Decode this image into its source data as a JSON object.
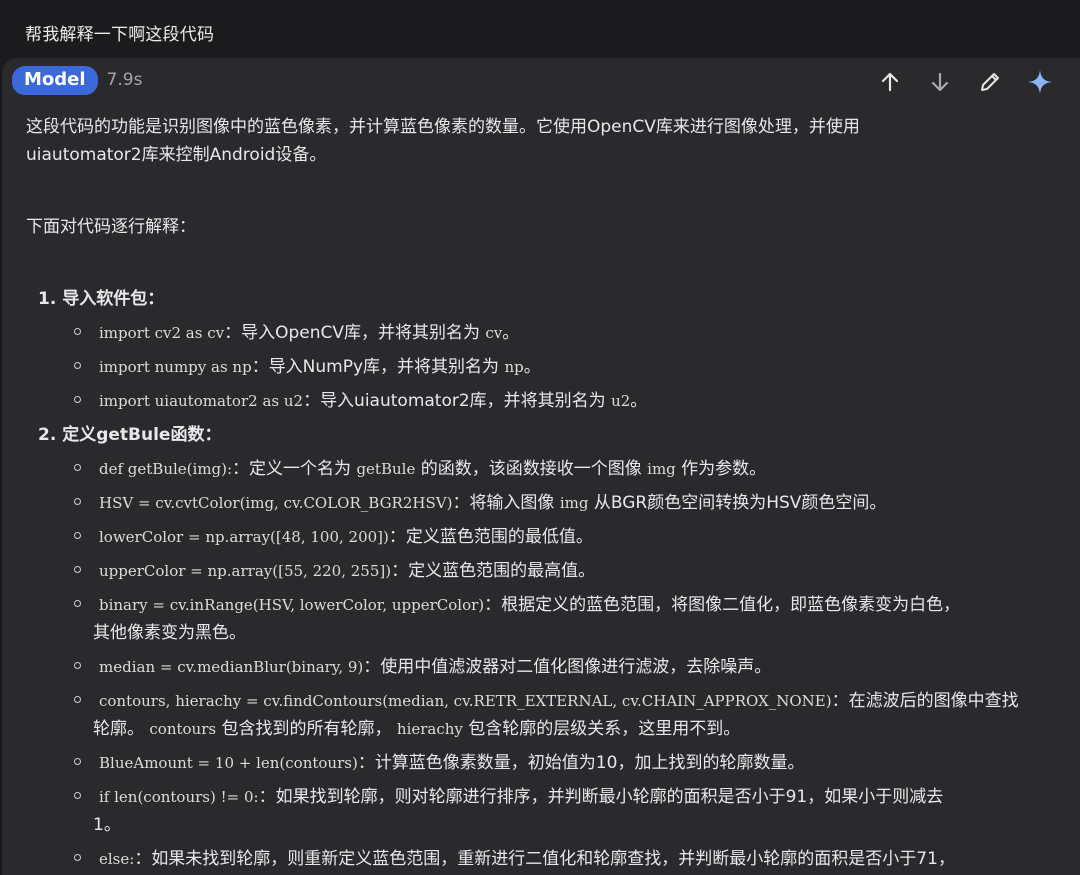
{
  "user_prompt": "帮我解释一下啊这段代码",
  "header": {
    "model_label": "Model",
    "time": "7.9s",
    "actions": [
      "arrow-up-icon",
      "arrow-down-icon",
      "pencil-icon",
      "sparkle-icon"
    ]
  },
  "intro": {
    "line1": "这段代码的功能是识别图像中的蓝色像素，并计算蓝色像素的数量。它使用OpenCV库来进行图像处理，并使用",
    "line2": "uiautomator2库来控制Android设备。"
  },
  "sub_intro": "下面对代码逐行解释：",
  "sections": [
    {
      "title": "1. 导入软件包：",
      "items": [
        {
          "code": "import cv2 as cv",
          "sep": "：",
          "text": "导入OpenCV库，并将其别名为",
          "code2": "cv",
          "tail": "。"
        },
        {
          "code": "import numpy as np",
          "sep": "：",
          "text": "导入NumPy库，并将其别名为",
          "code2": "np",
          "tail": "。"
        },
        {
          "code": "import uiautomator2 as u2",
          "sep": "：",
          "text": "导入uiautomator2库，并将其别名为",
          "code2": "u2",
          "tail": "。"
        }
      ]
    },
    {
      "title": "2. 定义getBule函数：",
      "items": [
        {
          "code": "def getBule(img):",
          "sep": "：",
          "text": "定义一个名为",
          "code2": "getBule",
          "text2": "的函数，该函数接收一个图像",
          "code3": "img",
          "text3": "作为参数。"
        },
        {
          "code": "HSV = cv.cvtColor(img, cv.COLOR_BGR2HSV)",
          "sep": "：",
          "text": "将输入图像",
          "code2": "img",
          "text2": "从BGR颜色空间转换为HSV颜色空间。"
        },
        {
          "code": "lowerColor = np.array([48, 100, 200])",
          "sep": "：",
          "text": "定义蓝色范围的最低值。"
        },
        {
          "code": "upperColor = np.array([55, 220, 255])",
          "sep": "：",
          "text": "定义蓝色范围的最高值。"
        },
        {
          "code": "binary = cv.inRange(HSV, lowerColor, upperColor)",
          "sep": "：",
          "text": "根据定义的蓝色范围，将图像二值化，即蓝色像素变为白色，",
          "line2": "其他像素变为黑色。"
        },
        {
          "code": "median = cv.medianBlur(binary, 9)",
          "sep": "：",
          "text": "使用中值滤波器对二值化图像进行滤波，去除噪声。"
        },
        {
          "code": "contours, hierachy = cv.findContours(median, cv.RETR_EXTERNAL, cv.CHAIN_APPROX_NONE)",
          "sep": "：",
          "text": "在滤波后的图像中查找",
          "line2_text": "轮廓。",
          "line2_code": "contours",
          "line2_text2": "包含找到的所有轮廓，",
          "line2_code2": "hierachy",
          "line2_text3": "包含轮廓的层级关系，这里用不到。"
        },
        {
          "code": "BlueAmount = 10 + len(contours)",
          "sep": "：",
          "text": "计算蓝色像素数量，初始值为10，加上找到的轮廓数量。"
        },
        {
          "code": "if len(contours) != 0:",
          "sep": "：",
          "text": "如果找到轮廓，则对轮廓进行排序，并判断最小轮廓的面积是否小于91，如果小于则减去",
          "line2": "1。"
        },
        {
          "code": "else:",
          "sep": "：",
          "text": "如果未找到轮廓，则重新定义蓝色范围，重新进行二值化和轮廓查找，并判断最小轮廓的面积是否小于71，"
        }
      ]
    }
  ],
  "colors": {
    "background": "#1b1b1d",
    "card": "#2a2a2d",
    "badge": "#3b69d9",
    "sparkle": "#8ab4f8"
  }
}
